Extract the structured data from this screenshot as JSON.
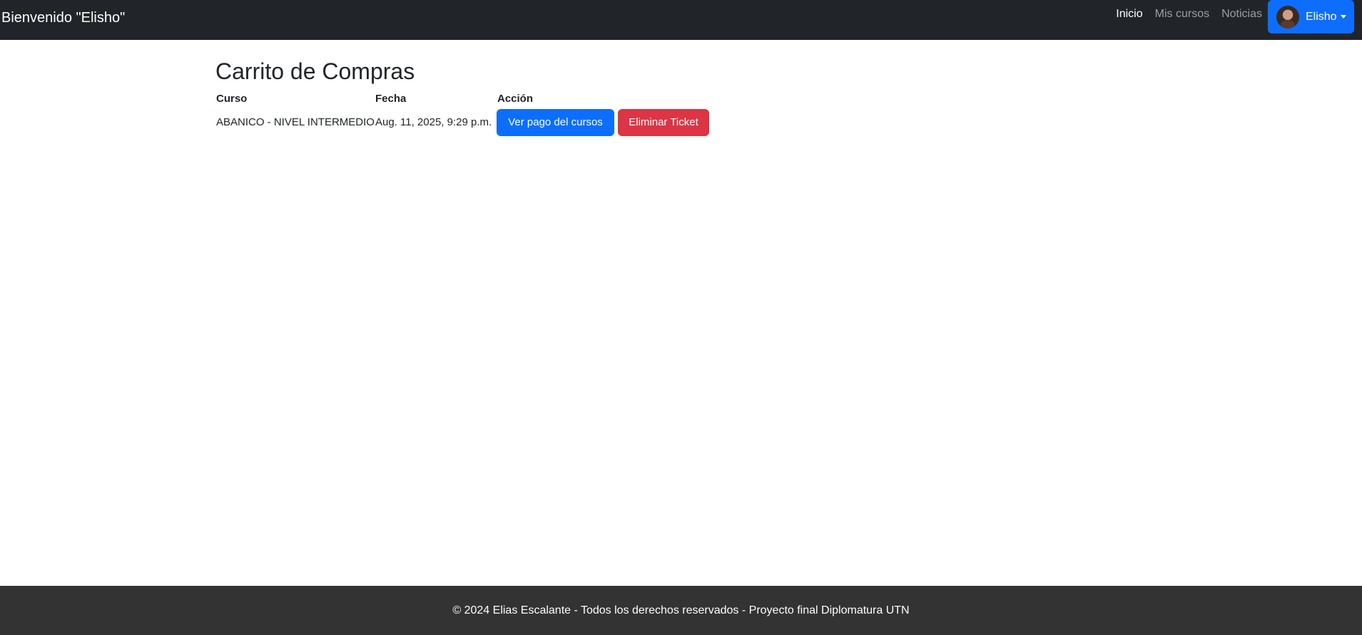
{
  "navbar": {
    "brand": "Bienvenido \"Elisho\"",
    "links": [
      {
        "label": "Inicio",
        "active": true
      },
      {
        "label": "Mis cursos",
        "active": false
      },
      {
        "label": "Noticias",
        "active": false
      }
    ],
    "user": {
      "name": "Elisho",
      "avatar_icon": "avatar-photo"
    },
    "accent_color": "#0d6efd"
  },
  "main": {
    "title": "Carrito de Compras",
    "table": {
      "headers": [
        "Curso",
        "Fecha",
        "Acción"
      ],
      "rows": [
        {
          "curso": "ABANICO - NIVEL INTERMEDIO",
          "fecha": "Aug. 11, 2025, 9:29 p.m.",
          "actions": {
            "view": "Ver pago del cursos",
            "delete": "Eliminar Ticket"
          }
        }
      ]
    },
    "button_colors": {
      "view": "#0d6efd",
      "delete": "#dc3545"
    }
  },
  "footer": {
    "text": "© 2024 Elias Escalante - Todos los derechos reservados - Proyecto final Diplomatura UTN"
  }
}
